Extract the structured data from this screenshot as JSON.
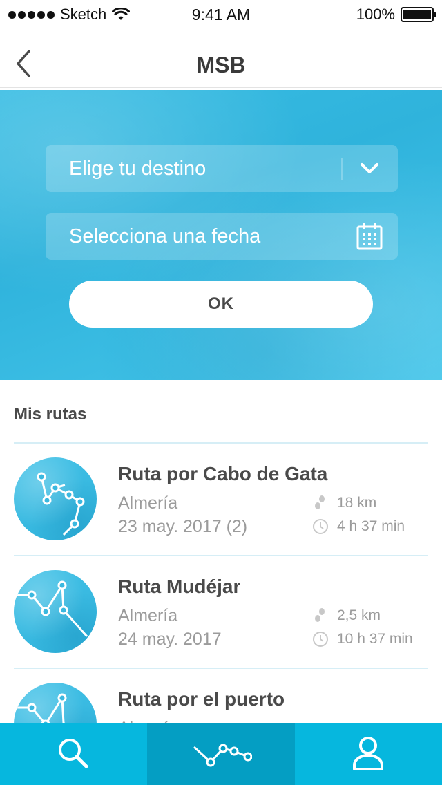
{
  "status_bar": {
    "carrier": "Sketch",
    "time": "9:41 AM",
    "battery": "100%"
  },
  "nav": {
    "title": "MSB"
  },
  "search": {
    "destination_placeholder": "Elige tu destino",
    "date_placeholder": "Selecciona una fecha",
    "ok_label": "OK"
  },
  "routes_section": {
    "title": "Mis rutas",
    "items": [
      {
        "title": "Ruta por Cabo de Gata",
        "place": "Almería",
        "date": "23 may. 2017 (2)",
        "distance": "18 km",
        "duration": "4 h 37 min"
      },
      {
        "title": "Ruta Mudéjar",
        "place": "Almería",
        "date": "24 may. 2017",
        "distance": "2,5 km",
        "duration": "10 h 37 min"
      },
      {
        "title": "Ruta por el puerto",
        "place": "Almería",
        "date": "",
        "distance": "",
        "duration": ""
      }
    ]
  },
  "tab_bar": {
    "tabs": [
      {
        "icon": "search-icon",
        "active": false
      },
      {
        "icon": "route-icon",
        "active": true
      },
      {
        "icon": "profile-icon",
        "active": false
      }
    ]
  },
  "colors": {
    "accent": "#06b7de",
    "accent_dark": "#049ec3",
    "hero": "#39bde3",
    "text": "#4a4a4a",
    "muted": "#9b9b9b"
  }
}
